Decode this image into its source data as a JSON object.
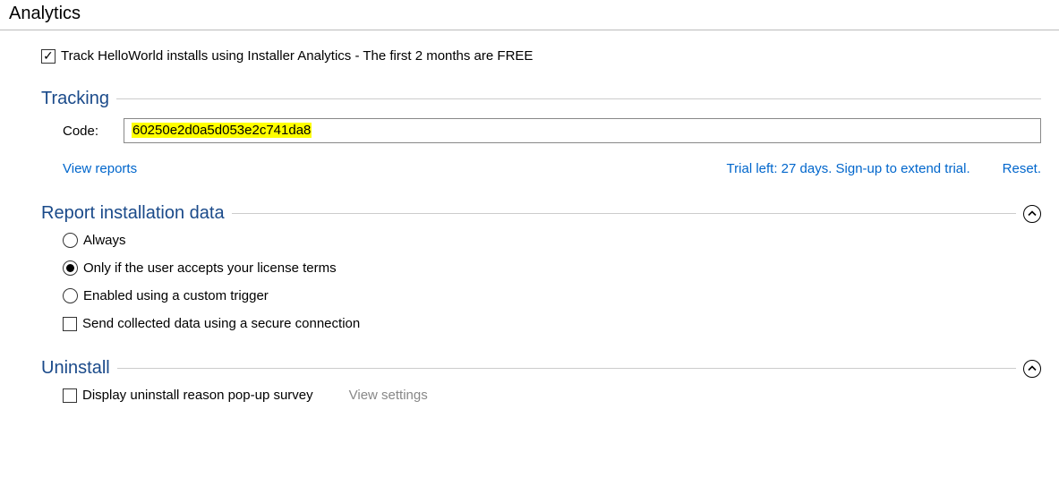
{
  "page": {
    "title": "Analytics"
  },
  "top": {
    "track_checked": true,
    "track_label": "Track HelloWorld installs using Installer Analytics - The first 2 months are FREE"
  },
  "tracking": {
    "title": "Tracking",
    "code_label": "Code:",
    "code_value": "60250e2d0a5d053e2c741da8",
    "view_reports": "View reports",
    "trial_text": "Trial left: 27 days. Sign-up to extend trial.",
    "reset": "Reset."
  },
  "report": {
    "title": "Report installation data",
    "options": [
      {
        "label": "Always",
        "selected": false
      },
      {
        "label": "Only if the user accepts your license terms",
        "selected": true
      },
      {
        "label": "Enabled using a custom trigger",
        "selected": false
      }
    ],
    "secure_checked": false,
    "secure_label": "Send collected data using a secure connection"
  },
  "uninstall": {
    "title": "Uninstall",
    "display_checked": false,
    "display_label": "Display uninstall reason pop-up survey",
    "view_settings": "View settings"
  }
}
